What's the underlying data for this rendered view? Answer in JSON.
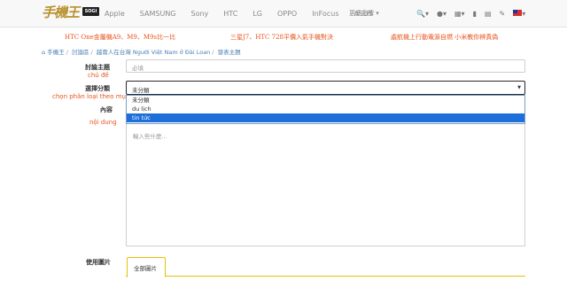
{
  "brand": {
    "logo_text": "手機王",
    "badge": "SOGI"
  },
  "nav": {
    "brands": [
      "Apple",
      "SAMSUNG",
      "Sony",
      "HTC",
      "LG",
      "OPPO",
      "InFocus",
      "ASUS"
    ],
    "more": "更多品牌 ▾"
  },
  "promos": [
    "HTC One金屬機A9、M9、M9s比一比",
    "三星J7、HTC 728平價入氣手機對決",
    "處航機上行動電源自燃 小米教你辨真偽"
  ],
  "breadcrumb": [
    "手機王",
    "討論區",
    "越南人在台灣 Người Việt Nam ở Đài Loan",
    "發表主題"
  ],
  "form": {
    "subject": {
      "label": "討論主題",
      "annotation": "chủ đề",
      "placeholder": "必填"
    },
    "category": {
      "label": "選擇分類",
      "annotation": "chọn phân loại theo mục",
      "selected": "未分類",
      "options": [
        "未分類",
        "du lịch",
        "tin tức"
      ]
    },
    "content": {
      "label": "內容",
      "annotation": "nội dung",
      "placeholder": "輸入些什麼..."
    },
    "images": {
      "label": "使用圖片",
      "tab": "全部圖片"
    }
  },
  "colors": {
    "accent": "#e8541c",
    "link": "#4a7fb5",
    "highlight": "#1e6fd9"
  }
}
